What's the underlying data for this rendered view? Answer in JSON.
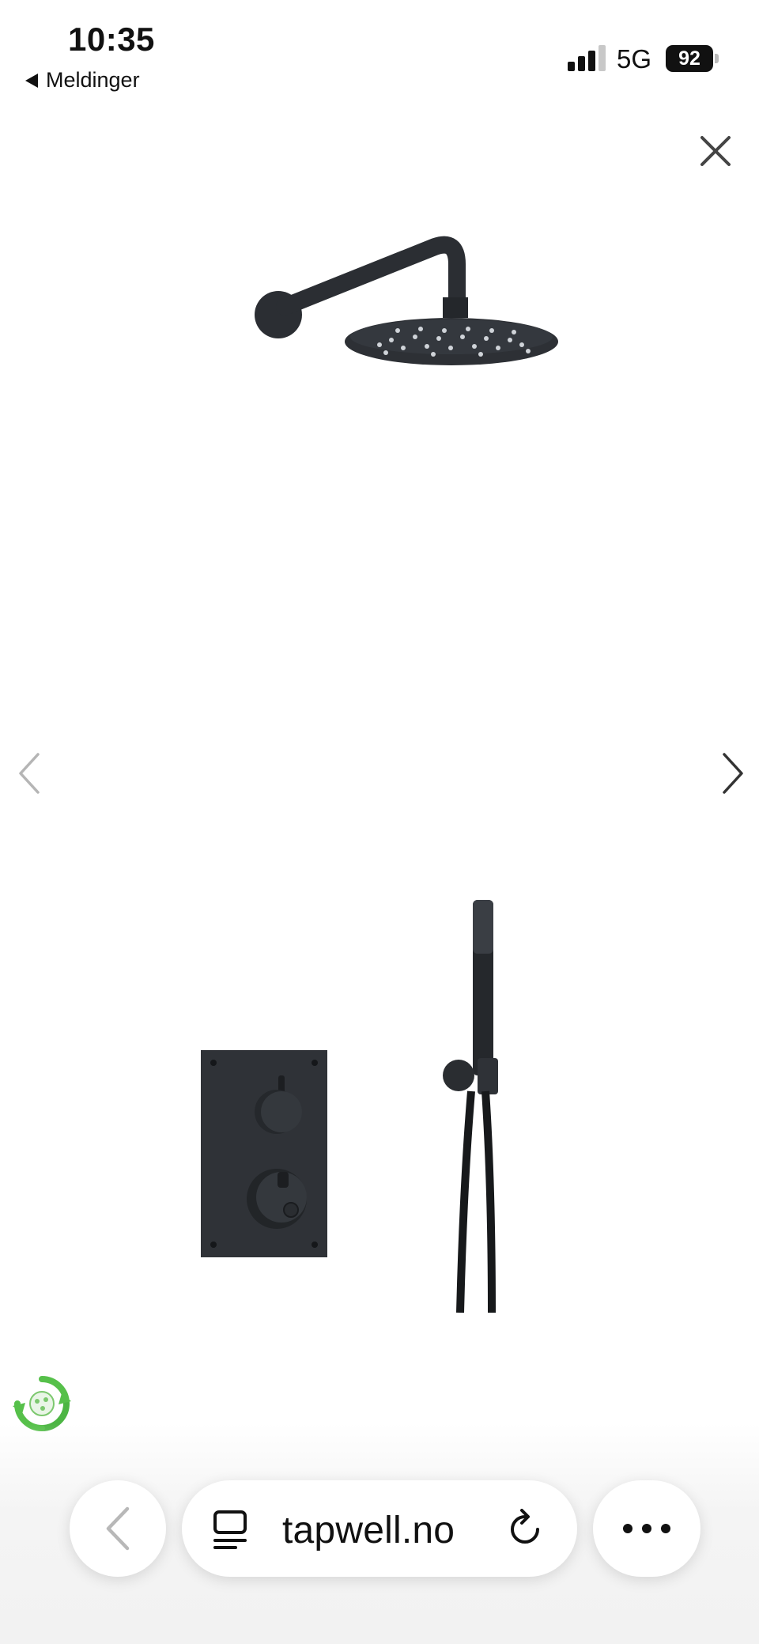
{
  "status_bar": {
    "time": "10:35",
    "back_app": "Meldinger",
    "network": "5G",
    "battery": "92",
    "signal_icon": "signal-bars-icon"
  },
  "viewer": {
    "close_icon": "close-icon",
    "prev_icon": "chevron-left-icon",
    "next_icon": "chevron-right-icon",
    "badge_icon": "eco-recycle-icon"
  },
  "browser": {
    "url": "tapwell.no",
    "back_icon": "chevron-left-icon",
    "reader_icon": "reader-icon",
    "reload_icon": "reload-icon",
    "more_icon": "more-dots-icon"
  },
  "colors": {
    "product": "#2b2e33",
    "badge": "#56c04a"
  }
}
